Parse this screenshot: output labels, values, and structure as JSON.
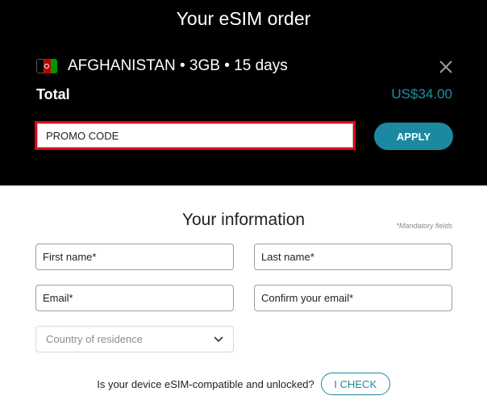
{
  "order": {
    "title": "Your eSIM order",
    "product": "AFGHANISTAN • 3GB • 15 days",
    "flag_colors": [
      "#000000",
      "#be0000",
      "#009900"
    ],
    "total_label": "Total",
    "total_value": "US$34.00",
    "close_icon": "close-icon",
    "promo": {
      "placeholder": "PROMO CODE",
      "value": ""
    },
    "apply_label": "APPLY"
  },
  "info": {
    "title": "Your information",
    "mandatory_note": "*Mandatory fields",
    "fields": {
      "first_name": "First name*",
      "last_name": "Last name*",
      "email": "Email*",
      "confirm_email": "Confirm your email*"
    },
    "country_placeholder": "Country of residence",
    "compat_question": "Is your device eSIM-compatible and unlocked?",
    "check_label": "I CHECK"
  },
  "colors": {
    "accent": "#1b8aa0",
    "highlight_border": "#e3001b",
    "header_bg": "#000000"
  }
}
